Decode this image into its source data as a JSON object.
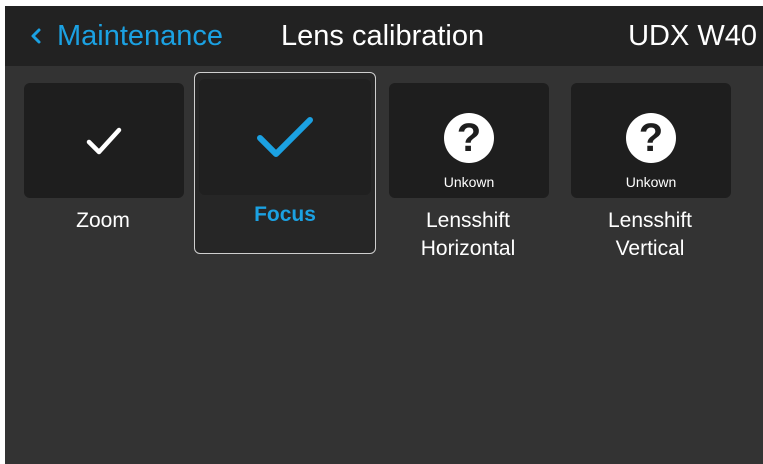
{
  "header": {
    "back_label": "Maintenance",
    "title": "Lens calibration",
    "model": "UDX W40"
  },
  "colors": {
    "accent": "#1ba1e2",
    "background": "#333333",
    "header_bg": "#222222",
    "tile_bg": "#1e1e1e"
  },
  "tiles": [
    {
      "label": "Zoom",
      "status_icon": "check-icon",
      "status_text": "",
      "selected": false
    },
    {
      "label": "Focus",
      "status_icon": "check-icon",
      "status_text": "",
      "selected": true
    },
    {
      "label_line1": "Lensshift",
      "label_line2": "Horizontal",
      "status_icon": "question-icon",
      "qmark": "?",
      "status_text": "Unkown",
      "selected": false
    },
    {
      "label_line1": "Lensshift",
      "label_line2": "Vertical",
      "status_icon": "question-icon",
      "qmark": "?",
      "status_text": "Unkown",
      "selected": false
    }
  ]
}
